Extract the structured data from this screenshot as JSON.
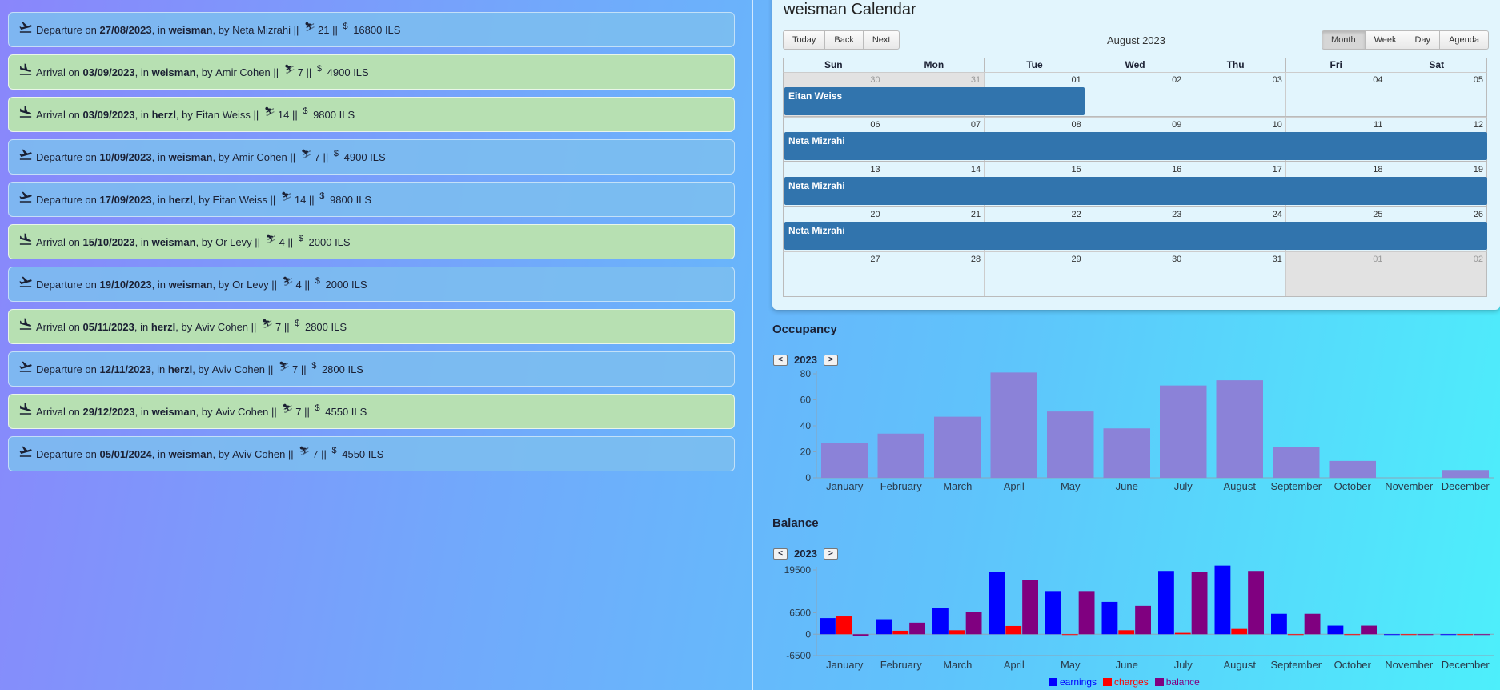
{
  "trips": [
    {
      "kind": "departure",
      "prefix": "Departure on",
      "date": "27/08/2023",
      "place": "weisman",
      "person": "Neta Mizrahi",
      "people": "21",
      "price": "16800 ILS"
    },
    {
      "kind": "arrival",
      "prefix": "Arrival on",
      "date": "03/09/2023",
      "place": "weisman",
      "person": "Amir Cohen",
      "people": "7",
      "price": "4900 ILS"
    },
    {
      "kind": "arrival",
      "prefix": "Arrival on",
      "date": "03/09/2023",
      "place": "herzl",
      "person": "Eitan Weiss",
      "people": "14",
      "price": "9800 ILS"
    },
    {
      "kind": "departure",
      "prefix": "Departure on",
      "date": "10/09/2023",
      "place": "weisman",
      "person": "Amir Cohen",
      "people": "7",
      "price": "4900 ILS"
    },
    {
      "kind": "departure",
      "prefix": "Departure on",
      "date": "17/09/2023",
      "place": "herzl",
      "person": "Eitan Weiss",
      "people": "14",
      "price": "9800 ILS"
    },
    {
      "kind": "arrival",
      "prefix": "Arrival on",
      "date": "15/10/2023",
      "place": "weisman",
      "person": "Or Levy",
      "people": "4",
      "price": "2000 ILS"
    },
    {
      "kind": "departure",
      "prefix": "Departure on",
      "date": "19/10/2023",
      "place": "weisman",
      "person": "Or Levy",
      "people": "4",
      "price": "2000 ILS"
    },
    {
      "kind": "arrival",
      "prefix": "Arrival on",
      "date": "05/11/2023",
      "place": "herzl",
      "person": "Aviv Cohen",
      "people": "7",
      "price": "2800 ILS"
    },
    {
      "kind": "departure",
      "prefix": "Departure on",
      "date": "12/11/2023",
      "place": "herzl",
      "person": "Aviv Cohen",
      "people": "7",
      "price": "2800 ILS"
    },
    {
      "kind": "arrival",
      "prefix": "Arrival on",
      "date": "29/12/2023",
      "place": "weisman",
      "person": "Aviv Cohen",
      "people": "7",
      "price": "4550 ILS"
    },
    {
      "kind": "departure",
      "prefix": "Departure on",
      "date": "05/01/2024",
      "place": "weisman",
      "person": "Aviv Cohen",
      "people": "7",
      "price": "4550 ILS"
    }
  ],
  "trip_text": {
    "in": ", in ",
    "by": ", by ",
    "sep": " || ",
    "people_icon": "⛷",
    "price_icon": "$"
  },
  "calendar": {
    "title": "weisman Calendar",
    "nav": {
      "today": "Today",
      "back": "Back",
      "next": "Next"
    },
    "month_label": "August 2023",
    "views": {
      "month": "Month",
      "week": "Week",
      "day": "Day",
      "agenda": "Agenda"
    },
    "active_view": "Month",
    "weekdays": [
      "Sun",
      "Mon",
      "Tue",
      "Wed",
      "Thu",
      "Fri",
      "Sat"
    ],
    "weeks": [
      {
        "days": [
          {
            "n": "30",
            "off": true
          },
          {
            "n": "31",
            "off": true
          },
          {
            "n": "01"
          },
          {
            "n": "02"
          },
          {
            "n": "03"
          },
          {
            "n": "04"
          },
          {
            "n": "05"
          }
        ],
        "events": [
          {
            "label": "Eitan Weiss",
            "start_col": 0,
            "span": 3
          }
        ]
      },
      {
        "days": [
          {
            "n": "06"
          },
          {
            "n": "07"
          },
          {
            "n": "08"
          },
          {
            "n": "09"
          },
          {
            "n": "10"
          },
          {
            "n": "11"
          },
          {
            "n": "12"
          }
        ],
        "events": [
          {
            "label": "Neta Mizrahi",
            "start_col": 0,
            "span": 7
          }
        ]
      },
      {
        "days": [
          {
            "n": "13"
          },
          {
            "n": "14"
          },
          {
            "n": "15"
          },
          {
            "n": "16"
          },
          {
            "n": "17"
          },
          {
            "n": "18"
          },
          {
            "n": "19"
          }
        ],
        "events": [
          {
            "label": "Neta Mizrahi",
            "start_col": 0,
            "span": 7
          }
        ]
      },
      {
        "days": [
          {
            "n": "20"
          },
          {
            "n": "21"
          },
          {
            "n": "22"
          },
          {
            "n": "23"
          },
          {
            "n": "24"
          },
          {
            "n": "25"
          },
          {
            "n": "26"
          }
        ],
        "events": [
          {
            "label": "Neta Mizrahi",
            "start_col": 0,
            "span": 7
          }
        ]
      },
      {
        "days": [
          {
            "n": "27"
          },
          {
            "n": "28"
          },
          {
            "n": "29"
          },
          {
            "n": "30"
          },
          {
            "n": "31"
          },
          {
            "n": "01",
            "off": true
          },
          {
            "n": "02",
            "off": true
          }
        ],
        "events": []
      }
    ]
  },
  "occupancy": {
    "title": "Occupancy",
    "year": "2023",
    "prev": "<",
    "next": ">"
  },
  "balance": {
    "title": "Balance",
    "year": "2023",
    "prev": "<",
    "next": ">"
  },
  "chart_data": [
    {
      "type": "bar",
      "title": "Occupancy",
      "categories": [
        "January",
        "February",
        "March",
        "April",
        "May",
        "June",
        "July",
        "August",
        "September",
        "October",
        "November",
        "December"
      ],
      "values": [
        27,
        34,
        47,
        81,
        51,
        38,
        71,
        75,
        24,
        13,
        0,
        6
      ],
      "ylim": [
        0,
        80
      ],
      "yticks": [
        0,
        20,
        40,
        60,
        80
      ],
      "color": "#8b82d8"
    },
    {
      "type": "bar",
      "title": "Balance",
      "categories": [
        "January",
        "February",
        "March",
        "April",
        "May",
        "June",
        "July",
        "August",
        "September",
        "October",
        "November",
        "December"
      ],
      "series": [
        {
          "name": "earnings",
          "color": "#0000ff",
          "values": [
            4900,
            4550,
            7900,
            18900,
            13100,
            9800,
            19200,
            20800,
            6200,
            2600,
            0,
            0
          ]
        },
        {
          "name": "charges",
          "color": "#ff0000",
          "values": [
            5400,
            1050,
            1200,
            2500,
            0,
            1200,
            400,
            1600,
            0,
            0,
            0,
            0
          ]
        },
        {
          "name": "balance",
          "color": "#800080",
          "values": [
            -500,
            3500,
            6700,
            16400,
            13100,
            8600,
            18800,
            19200,
            6200,
            2600,
            -200,
            -200
          ]
        }
      ],
      "ylim": [
        -6500,
        19500
      ],
      "yticks": [
        -6500,
        0,
        6500,
        19500
      ],
      "legend_position": "bottom-center"
    }
  ]
}
